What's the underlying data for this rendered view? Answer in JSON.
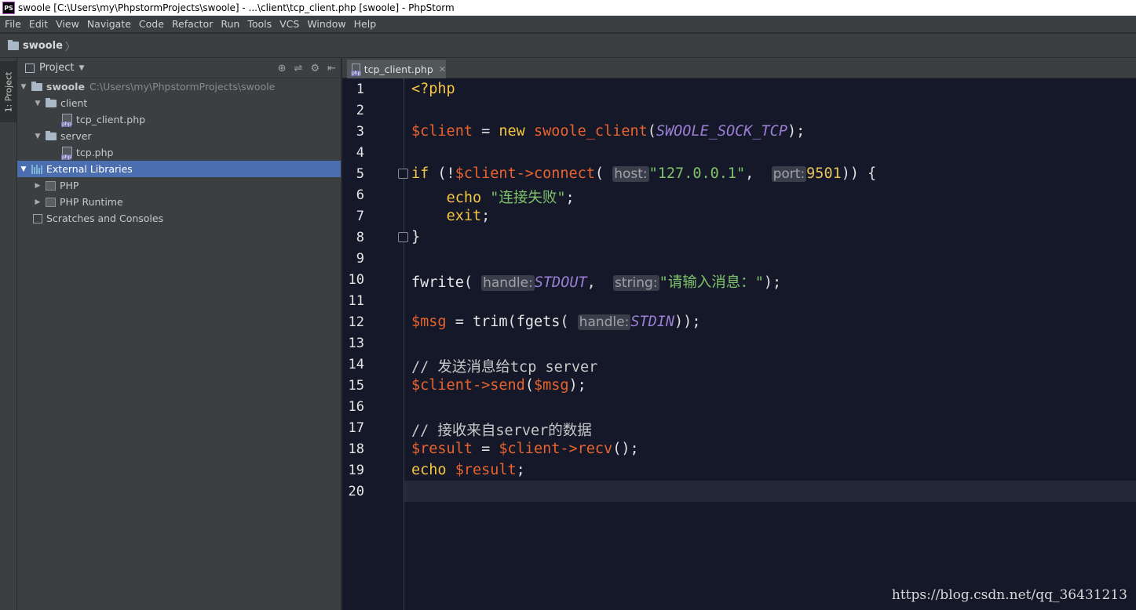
{
  "window": {
    "title": "swoole [C:\\Users\\my\\PhpstormProjects\\swoole] - ...\\client\\tcp_client.php [swoole] - PhpStorm",
    "logo_text": "PS"
  },
  "menu": [
    "File",
    "Edit",
    "View",
    "Navigate",
    "Code",
    "Refactor",
    "Run",
    "Tools",
    "VCS",
    "Window",
    "Help"
  ],
  "navbar": {
    "project": "swoole"
  },
  "toolstrip": {
    "project_tab": "1: Project"
  },
  "project_panel": {
    "header": "Project",
    "tree": [
      {
        "label": "swoole",
        "path": "C:\\Users\\my\\PhpstormProjects\\swoole"
      },
      {
        "label": "client"
      },
      {
        "label": "tcp_client.php"
      },
      {
        "label": "server"
      },
      {
        "label": "tcp.php"
      },
      {
        "label": "External Libraries"
      },
      {
        "label": "PHP"
      },
      {
        "label": "PHP Runtime"
      },
      {
        "label": "Scratches and Consoles"
      }
    ]
  },
  "editor": {
    "tab": "tcp_client.php",
    "current_line": 20,
    "line_numbers": [
      "1",
      "2",
      "3",
      "4",
      "5",
      "6",
      "7",
      "8",
      "9",
      "10",
      "11",
      "12",
      "13",
      "14",
      "15",
      "16",
      "17",
      "18",
      "19",
      "20"
    ],
    "tokens": {
      "php_open": "<?php",
      "client_var": "$client",
      "assign": " = ",
      "new_kw": "new ",
      "swoole_client": "swoole_client",
      "sock_const": "SWOOLE_SOCK_TCP",
      "if_kw": "if",
      "connect": "connect",
      "hint_host": "host:",
      "host_str": "\"127.0.0.1\"",
      "hint_port": "port:",
      "port_num": "9501",
      "echo_kw": "echo",
      "fail_str": "\"连接失败\"",
      "exit_kw": "exit",
      "fwrite": "fwrite",
      "hint_handle": "handle:",
      "stdout": "STDOUT",
      "hint_string": "string:",
      "prompt_str": "\"请输入消息：\"",
      "msg_var": "$msg",
      "trim": "trim",
      "fgets": "fgets",
      "stdin": "STDIN",
      "comment_send": "// 发送消息给tcp server",
      "send": "send",
      "comment_recv": "// 接收来自server的数据",
      "result_var": "$result",
      "recv": "recv"
    }
  },
  "watermark": "https://blog.csdn.net/qq_36431213"
}
